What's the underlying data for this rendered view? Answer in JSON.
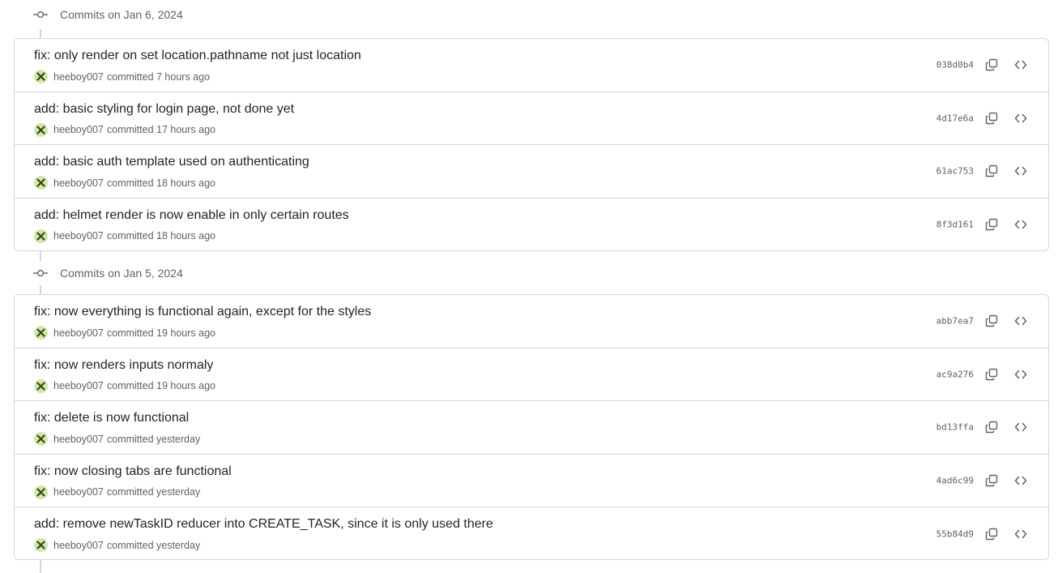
{
  "groups": [
    {
      "title": "Commits on Jan 6, 2024",
      "commits": [
        {
          "message": "fix: only render on set location.pathname not just location",
          "author": "heeboy007",
          "committed": "committed 7 hours ago",
          "sha": "038d0b4"
        },
        {
          "message": "add: basic styling for login page, not done yet",
          "author": "heeboy007",
          "committed": "committed 17 hours ago",
          "sha": "4d17e6a"
        },
        {
          "message": "add: basic auth template used on authenticating",
          "author": "heeboy007",
          "committed": "committed 18 hours ago",
          "sha": "61ac753"
        },
        {
          "message": "add: helmet render is now enable in only certain routes",
          "author": "heeboy007",
          "committed": "committed 18 hours ago",
          "sha": "8f3d161"
        }
      ]
    },
    {
      "title": "Commits on Jan 5, 2024",
      "commits": [
        {
          "message": "fix: now everything is functional again, except for the styles",
          "author": "heeboy007",
          "committed": "committed 19 hours ago",
          "sha": "abb7ea7"
        },
        {
          "message": "fix: now renders inputs normaly",
          "author": "heeboy007",
          "committed": "committed 19 hours ago",
          "sha": "ac9a276"
        },
        {
          "message": "fix: delete is now functional",
          "author": "heeboy007",
          "committed": "committed yesterday",
          "sha": "bd13ffa"
        },
        {
          "message": "fix: now closing tabs are functional",
          "author": "heeboy007",
          "committed": "committed yesterday",
          "sha": "4ad6c99"
        },
        {
          "message": "add: remove newTaskID reducer into CREATE_TASK, since it is only used there",
          "author": "heeboy007",
          "committed": "committed yesterday",
          "sha": "55b84d9"
        }
      ]
    }
  ],
  "icons": {
    "timeline": "git-commit-icon",
    "avatar": "avatar-x-icon",
    "copy": "copy-icon",
    "browse": "code-icon"
  },
  "colors": {
    "border": "#d0d7de",
    "muted_text": "#59636e",
    "avatar_bg": "#d6e4ad",
    "avatar_mark": "#2a4d14"
  }
}
